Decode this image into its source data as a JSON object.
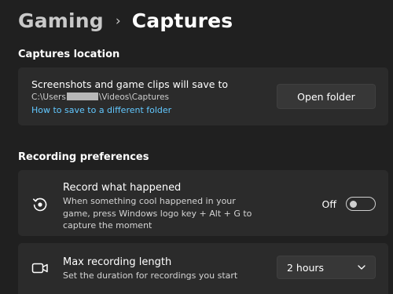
{
  "breadcrumb": {
    "parent": "Gaming",
    "separator": "›",
    "current": "Captures"
  },
  "captures_location": {
    "section_title": "Captures location",
    "description": "Screenshots and game clips will save to",
    "path_prefix": "C:\\Users",
    "path_suffix": "\\Videos\\Captures",
    "link": "How to save to a different folder",
    "open_folder_button": "Open folder"
  },
  "recording_preferences": {
    "section_title": "Recording preferences",
    "record_what_happened": {
      "title": "Record what happened",
      "description": "When something cool happened in your game, press Windows logo key + Alt + G to capture the moment",
      "toggle_state_label": "Off",
      "toggle_on": false,
      "icon": "record-history-icon"
    },
    "max_recording_length": {
      "title": "Max recording length",
      "description": "Set the duration for recordings you start",
      "selected_value": "2 hours",
      "icon": "video-camera-icon"
    }
  },
  "colors": {
    "background": "#202020",
    "card": "#2b2b2b",
    "link": "#62c8ff",
    "button": "#373737"
  }
}
